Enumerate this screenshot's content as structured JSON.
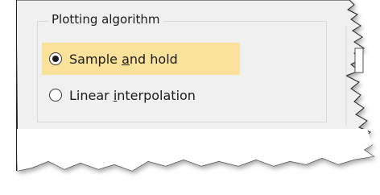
{
  "groupbox": {
    "title": "Plotting algorithm",
    "options": [
      {
        "label_pre": "Sample ",
        "label_accel": "a",
        "label_post": "nd hold",
        "selected": true
      },
      {
        "label_pre": "Linear ",
        "label_accel": "i",
        "label_post": "nterpolation",
        "selected": false
      }
    ]
  },
  "colors": {
    "panel": "#f0f0f0",
    "selection_highlight": "#fbe29a",
    "groupbox_border": "#d9d9d9",
    "text": "#1b1b1b"
  }
}
